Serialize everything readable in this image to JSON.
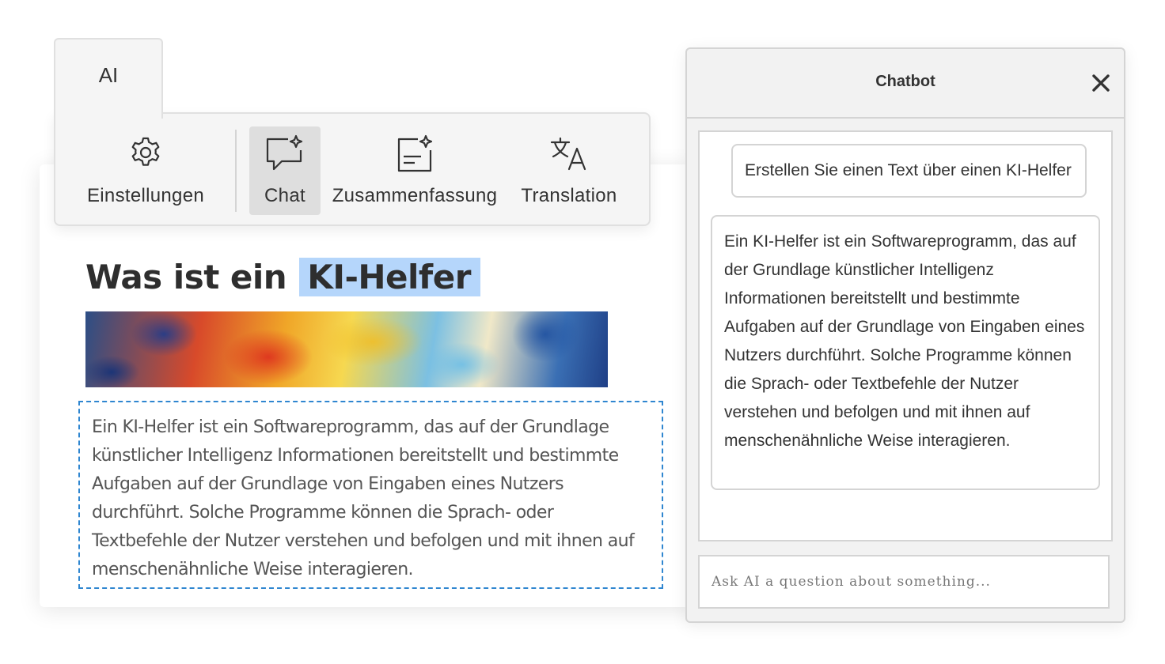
{
  "toolbar": {
    "tab_label": "AI",
    "buttons": [
      {
        "label": "Einstellungen",
        "icon": "gear-icon"
      },
      {
        "label": "Chat",
        "icon": "chat-sparkle-icon",
        "active": true
      },
      {
        "label": "Zusammenfassung",
        "icon": "summary-sparkle-icon"
      },
      {
        "label": "Translation",
        "icon": "translate-icon"
      }
    ]
  },
  "document": {
    "title_prefix": "Was ist ein",
    "title_highlight": "KI-Helfer",
    "body": "Ein KI-Helfer ist ein Softwareprogramm, das auf der Grundlage künstlicher Intelligenz Informationen bereitstellt und bestimmte Aufgaben auf der Grundlage von Eingaben eines Nutzers durchführt. Solche Programme können die Sprach- oder Textbefehle der Nutzer verstehen und befolgen und mit ihnen auf menschenähnliche Weise interagieren."
  },
  "chatbot": {
    "title": "Chatbot",
    "close_icon": "close-icon",
    "messages": [
      {
        "role": "user",
        "text": "Erstellen Sie einen Text über einen KI-Helfer"
      },
      {
        "role": "assistant",
        "text": "Ein KI-Helfer ist ein Softwareprogramm, das auf der Grundlage künstlicher Intelligenz Informationen bereitstellt und bestimmte Aufgaben auf der Grundlage von Eingaben eines Nutzers durchführt. Solche Programme können die Sprach- oder Textbefehle der Nutzer verstehen und befolgen und mit ihnen auf menschenähnliche Weise interagieren."
      }
    ],
    "input_placeholder": "Ask AI a question about something...",
    "input_value": ""
  },
  "colors": {
    "highlight": "#b5d6fb",
    "dashed_border": "#2f86d0",
    "active_button_bg": "#dedede"
  }
}
